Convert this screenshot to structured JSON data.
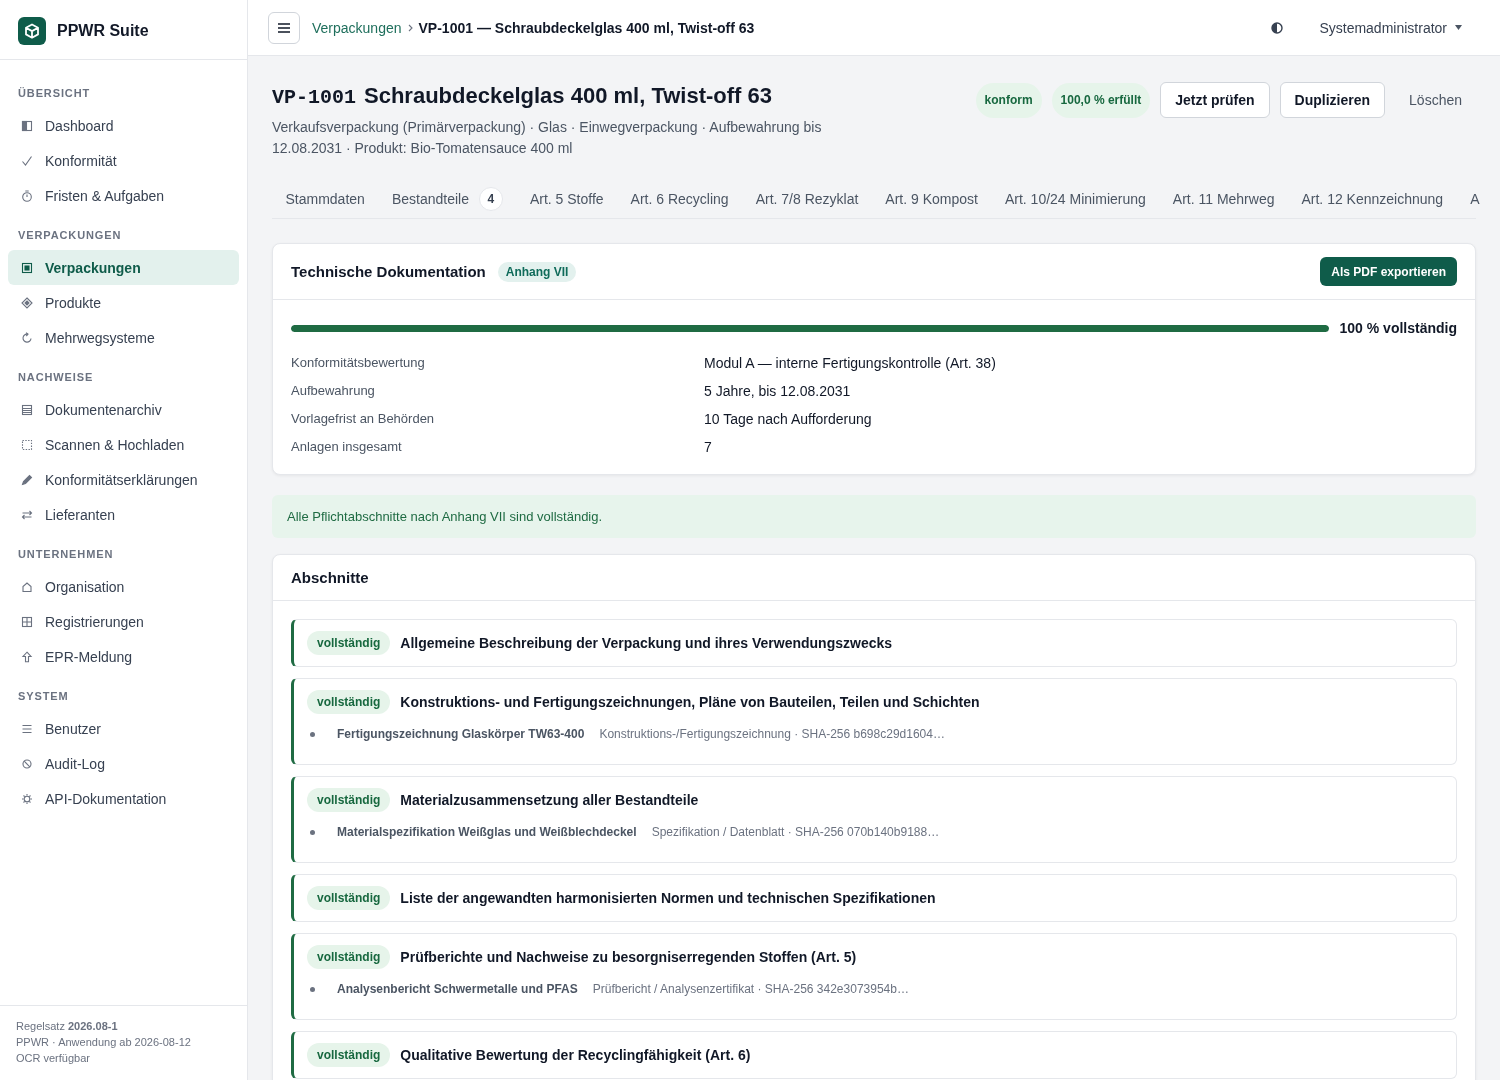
{
  "sidebar": {
    "brand": "PPWR Suite",
    "groups": [
      {
        "label": "ÜBERSICHT",
        "items": [
          {
            "label": "Dashboard",
            "selected": false
          },
          {
            "label": "Konformität",
            "selected": false
          },
          {
            "label": "Fristen & Aufgaben",
            "selected": false
          }
        ]
      },
      {
        "label": "VERPACKUNGEN",
        "items": [
          {
            "label": "Verpackungen",
            "selected": true
          },
          {
            "label": "Produkte",
            "selected": false
          },
          {
            "label": "Mehrwegsysteme",
            "selected": false
          }
        ]
      },
      {
        "label": "NACHWEISE",
        "items": [
          {
            "label": "Dokumentenarchiv",
            "selected": false
          },
          {
            "label": "Scannen & Hochladen",
            "selected": false
          },
          {
            "label": "Konformitätserklärungen",
            "selected": false
          },
          {
            "label": "Lieferanten",
            "selected": false
          }
        ]
      },
      {
        "label": "UNTERNEHMEN",
        "items": [
          {
            "label": "Organisation",
            "selected": false
          },
          {
            "label": "Registrierungen",
            "selected": false
          },
          {
            "label": "EPR-Meldung",
            "selected": false
          }
        ]
      },
      {
        "label": "SYSTEM",
        "items": [
          {
            "label": "Benutzer",
            "selected": false
          },
          {
            "label": "Audit-Log",
            "selected": false
          },
          {
            "label": "API-Dokumentation",
            "selected": false
          }
        ]
      }
    ],
    "footer": [
      "Regelsatz **2026.08-1**",
      "PPWR · Anwendung ab 2026-08-12",
      "OCR verfügbar"
    ]
  },
  "header": {
    "breadcrumb": [
      "Verpackungen",
      "VP-1001 — Schraubdeckelglas 400 ml, Twist-off 63"
    ],
    "user": "Systemadministrator"
  },
  "page": {
    "code": "VP-1001",
    "title": "Schraubdeckelglas 400 ml, Twist-off 63",
    "subtitle": "Verkaufsverpackung (Primärverpackung) · Glas · Einwegverpackung · Aufbewahrung bis 12.08.2031 · Produkt: Bio-Tomatensauce 400 ml",
    "badges": [
      "konform",
      "100,0 % erfüllt"
    ],
    "buttons": [
      {
        "label": "Jetzt prüfen",
        "kind": "outline"
      },
      {
        "label": "Duplizieren",
        "kind": "outline"
      },
      {
        "label": "Löschen",
        "kind": "text"
      }
    ]
  },
  "tabs": [
    {
      "label": "Stammdaten",
      "selected": false
    },
    {
      "label": "Bestandteile",
      "count": "4",
      "selected": false
    },
    {
      "label": "Art. 5 Stoffe",
      "selected": false
    },
    {
      "label": "Art. 6 Recycling",
      "selected": false
    },
    {
      "label": "Art. 7/8 Rezyklat",
      "selected": false
    },
    {
      "label": "Art. 9 Kompost",
      "selected": false
    },
    {
      "label": "Art. 10/24 Minimierung",
      "selected": false
    },
    {
      "label": "Art. 11 Mehrweg",
      "selected": false
    },
    {
      "label": "Art. 12 Kennzeichnung",
      "selected": false
    },
    {
      "label": "A",
      "selected": false
    }
  ],
  "tech_doc": {
    "title": "Technische Dokumentation",
    "badge": "Anhang VII",
    "export_button": "Als PDF exportieren",
    "progress": {
      "level": 1,
      "reading": "100 % vollständig"
    },
    "facts": [
      {
        "label": "Konformitätsbewertung",
        "value": "Modul A — interne Fertigungskontrolle (Art. 38)"
      },
      {
        "label": "Aufbewahrung",
        "value": "5 Jahre, bis 12.08.2031"
      },
      {
        "label": "Vorlagefrist an Behörden",
        "value": "10 Tage nach Aufforderung"
      },
      {
        "label": "Anlagen insgesamt",
        "value": "7"
      }
    ]
  },
  "notice": "Alle Pflichtabschnitte nach Anhang VII sind vollständig.",
  "sections": {
    "title": "Abschnitte",
    "items": [
      {
        "complete": true,
        "badge": "vollständig",
        "title": "Allgemeine Beschreibung der Verpackung und ihres Verwendungszwecks"
      },
      {
        "complete": true,
        "badge": "vollständig",
        "title": "Konstruktions- und Fertigungszeichnungen, Pläne von Bauteilen, Teilen und Schichten",
        "documents": [
          {
            "name": "Fertigungszeichnung Glaskörper TW63-400",
            "meta": "Konstruktions-/Fertigungszeichnung · SHA-256 b698c29d1604…"
          }
        ]
      },
      {
        "complete": true,
        "badge": "vollständig",
        "title": "Materialzusammensetzung aller Bestandteile",
        "documents": [
          {
            "name": "Materialspezifikation Weißglas und Weißblechdeckel",
            "meta": "Spezifikation / Datenblatt · SHA-256 070b140b9188…"
          }
        ]
      },
      {
        "complete": true,
        "badge": "vollständig",
        "title": "Liste der angewandten harmonisierten Normen und technischen Spezifikationen"
      },
      {
        "complete": true,
        "badge": "vollständig",
        "title": "Prüfberichte und Nachweise zu besorgniserregenden Stoffen (Art. 5)",
        "documents": [
          {
            "name": "Analysenbericht Schwermetalle und PFAS",
            "meta": "Prüfbericht / Analysenzertifikat · SHA-256 342e3073954b…"
          }
        ]
      },
      {
        "complete": true,
        "badge": "vollständig",
        "title": "Qualitative Bewertung der Recyclingfähigkeit (Art. 6)"
      }
    ]
  }
}
